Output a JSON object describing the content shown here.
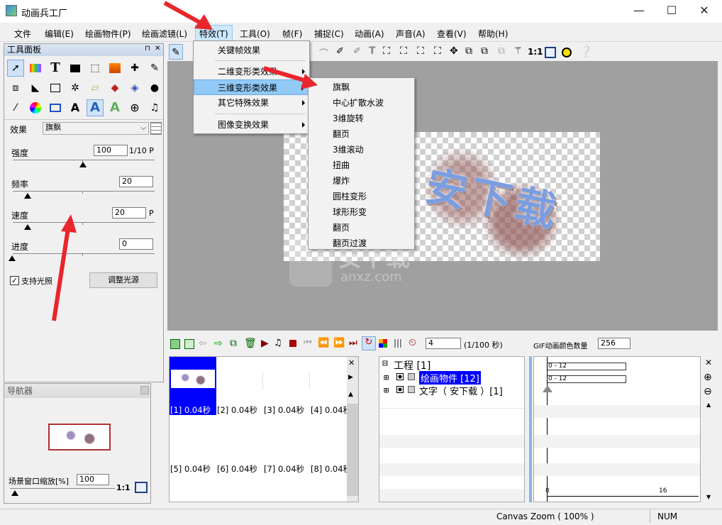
{
  "window": {
    "title": "动画兵工厂",
    "minimize": "—",
    "maximize": "☐",
    "close": "✕"
  },
  "menubar": [
    "文件",
    "编辑(E)",
    "绘画物件(P)",
    "绘画滤镜(L)",
    "特效(T)",
    "工具(O)",
    "帧(F)",
    "捕捉(C)",
    "动画(A)",
    "声音(A)",
    "查看(V)",
    "帮助(H)"
  ],
  "toolpanel": {
    "title": "工具面板",
    "pin": "⊓",
    "close": "✕",
    "effect_label": "效果",
    "effect_value": "旗飘",
    "params": [
      {
        "label": "强度",
        "value": "100",
        "unit": "1/10 P",
        "level": 0.5
      },
      {
        "label": "频率",
        "value": "20",
        "unit": "",
        "level": 0.1
      },
      {
        "label": "速度",
        "value": "20",
        "unit": "P",
        "level": 0.1
      },
      {
        "label": "进度",
        "value": "0",
        "unit": "",
        "level": 0.0
      }
    ],
    "lighting_checkbox": "支持光照",
    "lighting_checked": true,
    "adjust_light_button": "调整光源"
  },
  "navigator": {
    "title": "导航器",
    "zoom_label": "场景窗口缩放[%]",
    "zoom_value": "100",
    "one_to_one": "1:1"
  },
  "toolbar2": {
    "ratio_label": "1:1"
  },
  "effects_menu": {
    "items": [
      "关键帧效果",
      "二维变形类效果",
      "三维变形类效果",
      "其它特殊效果",
      "图像变换效果"
    ]
  },
  "submenu_3d": {
    "items": [
      "旗飘",
      "中心扩散水波",
      "3维旋转",
      "翻页",
      "3维滚动",
      "扭曲",
      "爆炸",
      "圆柱变形",
      "球形形变",
      "翻页",
      "翻页过渡"
    ]
  },
  "canvas_text": "安下载",
  "watermark": {
    "main": "安下载",
    "sub": "anxz.com"
  },
  "timeline": {
    "frame_value": "4",
    "frame_unit": "(1/100 秒)",
    "gif_label": "GIF动画颜色数量",
    "gif_value": "256",
    "frames_row1": [
      "[1] 0.04秒",
      "[2] 0.04秒",
      "[3] 0.04秒",
      "[4] 0.04秒"
    ],
    "frames_row2": [
      "[5] 0.04秒",
      "[6] 0.04秒",
      "[7] 0.04秒",
      "[8] 0.04秒"
    ],
    "tree": [
      {
        "label": "工程 [1]",
        "highlight": false
      },
      {
        "label": "绘画物件 [12]",
        "highlight": true
      },
      {
        "label": "文字（ 安下载 ）[1]",
        "highlight": false
      }
    ],
    "track_labels": [
      "0 - 12",
      "0 - 12"
    ],
    "ruler": [
      "0",
      "16"
    ]
  },
  "status": {
    "zoom": "Canvas Zoom ( 100% )",
    "num": "NUM"
  },
  "colors": {
    "highlight": "#0000ff",
    "menu_hl": "#91c9f7",
    "arrow": "#e8262b",
    "canvas_bg": "#a0a0a0"
  }
}
